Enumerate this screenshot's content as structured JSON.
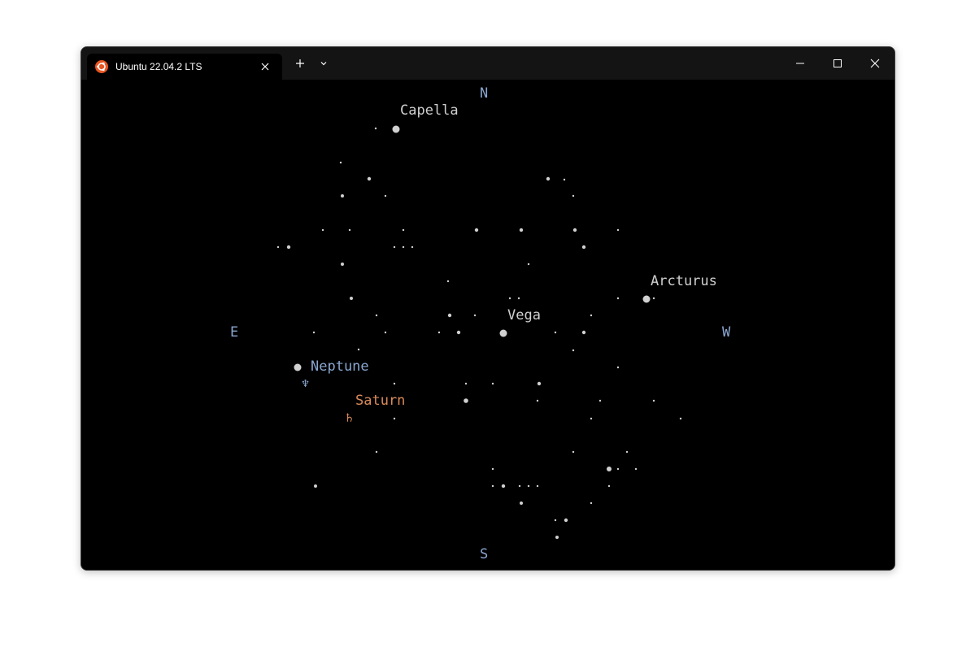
{
  "tab": {
    "title": "Ubuntu 22.04.2 LTS"
  },
  "colors": {
    "background": "#000000",
    "star": "#d0d0d0",
    "compass": "#8aa6d0",
    "neptune": "#8aa6d0",
    "saturn": "#d98a5a",
    "ubuntu_icon": "#e95420"
  },
  "icons": {
    "tab_icon": "ubuntu-logo-icon",
    "tab_close": "close-icon",
    "new_tab": "plus-icon",
    "dropdown": "chevron-down-icon",
    "minimize": "minimize-icon",
    "maximize": "maximize-icon",
    "close": "close-icon"
  },
  "compass": {
    "north": "N",
    "south": "S",
    "east": "E",
    "west": "W"
  },
  "stars": {
    "capella": "Capella",
    "arcturus": "Arcturus",
    "vega": "Vega"
  },
  "planets": {
    "neptune": {
      "name": "Neptune",
      "symbol": "♆"
    },
    "saturn": {
      "name": "Saturn",
      "symbol": "♄"
    }
  }
}
